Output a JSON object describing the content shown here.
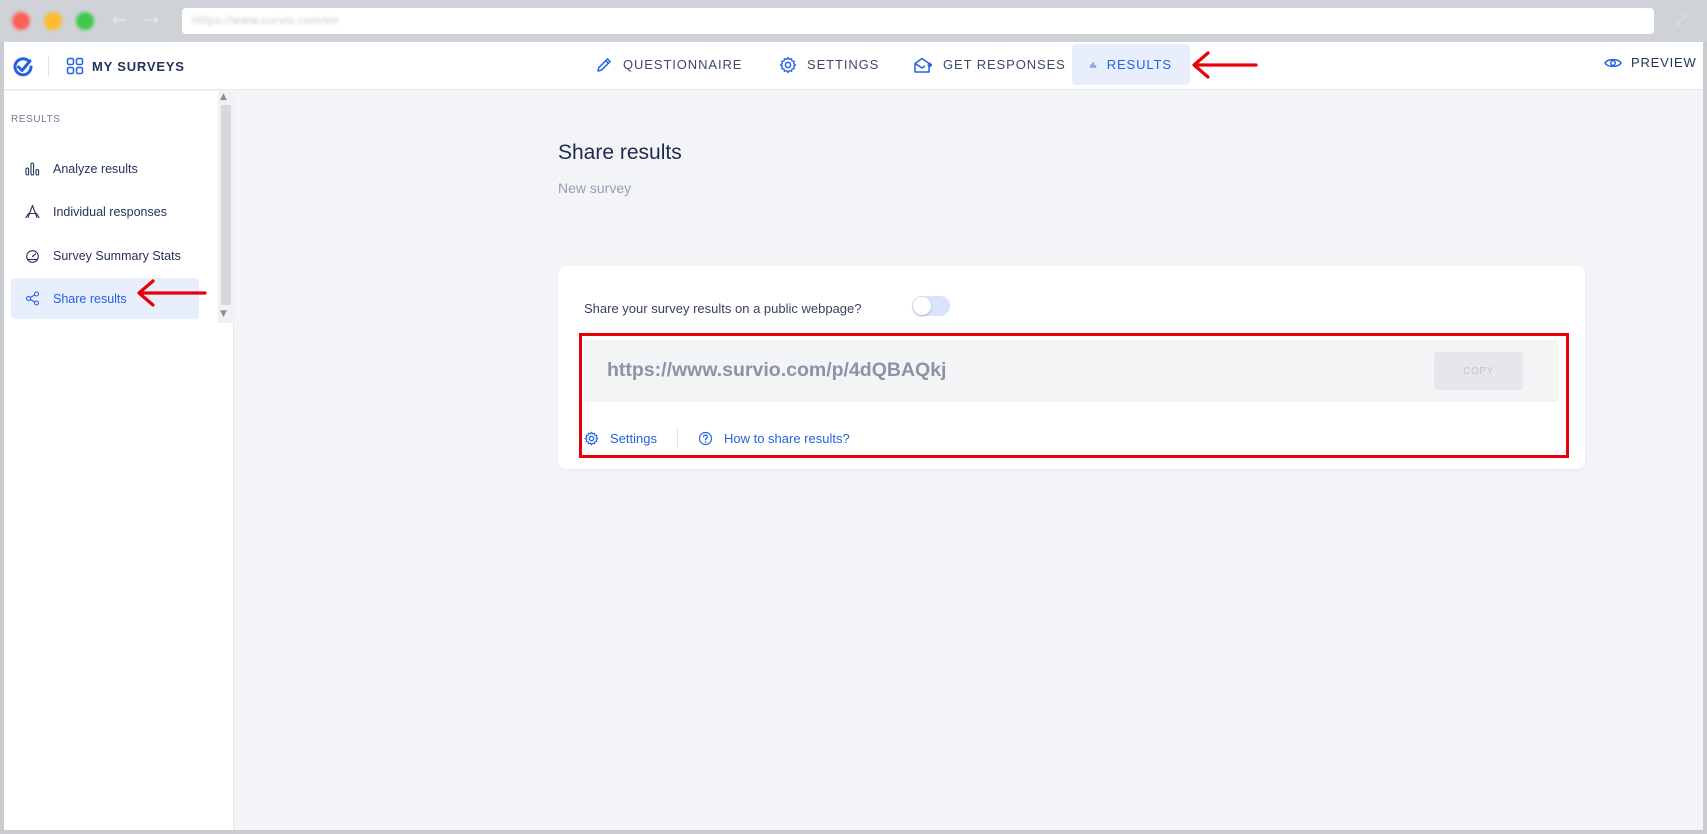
{
  "browser": {
    "url": "https://www.survio.com/en"
  },
  "nav": {
    "my_surveys": "MY SURVEYS",
    "tabs": [
      {
        "label": "QUESTIONNAIRE"
      },
      {
        "label": "SETTINGS"
      },
      {
        "label": "GET RESPONSES"
      },
      {
        "label": "RESULTS"
      }
    ],
    "active_tab": "RESULTS",
    "preview": "PREVIEW"
  },
  "sidebar": {
    "heading": "RESULTS",
    "items": [
      {
        "label": "Analyze results",
        "icon": "bar-chart-icon"
      },
      {
        "label": "Individual responses",
        "icon": "individual-responses-icon"
      },
      {
        "label": "Survey Summary Stats",
        "icon": "gauge-icon"
      },
      {
        "label": "Share results",
        "icon": "share-icon"
      }
    ],
    "active_item": "Share results"
  },
  "main": {
    "title": "Share results",
    "subtitle": "New survey",
    "share_question": "Share your survey results on a public webpage?",
    "toggle_on": false,
    "public_url": "https://www.survio.com/p/4dQBAQkj",
    "copy_label": "COPY",
    "settings_link": "Settings",
    "help_link": "How to share results?"
  },
  "colors": {
    "accent": "#2362e0",
    "annotation": "#e6000a",
    "text_dark": "#23335a",
    "background": "#f3f4f7"
  }
}
